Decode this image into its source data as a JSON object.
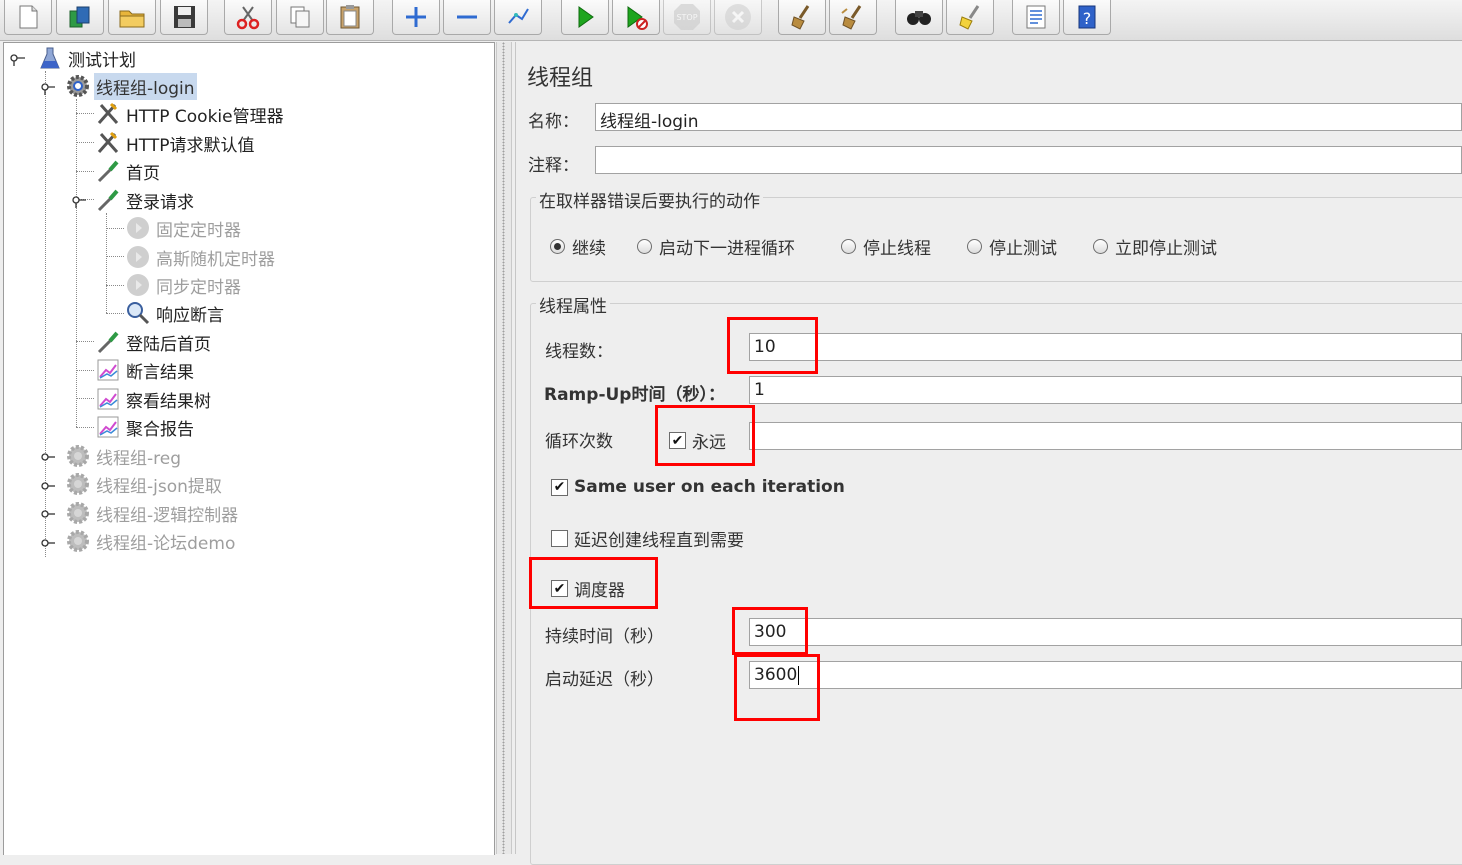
{
  "toolbar": {
    "buttons": [
      {
        "icon": "new-file-icon"
      },
      {
        "icon": "templates-icon"
      },
      {
        "icon": "open-folder-icon"
      },
      {
        "icon": "save-icon"
      },
      {
        "icon": "cut-icon"
      },
      {
        "icon": "copy-icon"
      },
      {
        "icon": "paste-icon"
      },
      {
        "icon": "expand-icon"
      },
      {
        "icon": "collapse-icon"
      },
      {
        "icon": "toggle-icon"
      },
      {
        "icon": "start-icon"
      },
      {
        "icon": "start-no-pauses-icon"
      },
      {
        "icon": "stop-icon",
        "label": "STOP"
      },
      {
        "icon": "shutdown-icon"
      },
      {
        "icon": "clear-icon"
      },
      {
        "icon": "clear-all-icon"
      },
      {
        "icon": "search-icon"
      },
      {
        "icon": "reset-search-icon"
      },
      {
        "icon": "function-helper-icon"
      },
      {
        "icon": "help-icon"
      }
    ]
  },
  "tree": {
    "nodes": [
      {
        "label": "测试计划",
        "icon": "test-plan-icon",
        "state": "normal"
      },
      {
        "label": "线程组-login",
        "icon": "thread-group-icon",
        "state": "selected"
      },
      {
        "label": "HTTP Cookie管理器",
        "icon": "config-element-icon",
        "state": "normal"
      },
      {
        "label": "HTTP请求默认值",
        "icon": "config-element-icon",
        "state": "normal"
      },
      {
        "label": "首页",
        "icon": "sampler-icon",
        "state": "normal"
      },
      {
        "label": "登录请求",
        "icon": "sampler-icon",
        "state": "normal"
      },
      {
        "label": "固定定时器",
        "icon": "timer-icon",
        "state": "disabled"
      },
      {
        "label": "高斯随机定时器",
        "icon": "timer-icon",
        "state": "disabled"
      },
      {
        "label": "同步定时器",
        "icon": "timer-icon",
        "state": "disabled"
      },
      {
        "label": "响应断言",
        "icon": "assertion-icon",
        "state": "normal"
      },
      {
        "label": "登陆后首页",
        "icon": "sampler-icon",
        "state": "normal"
      },
      {
        "label": "断言结果",
        "icon": "listener-icon",
        "state": "normal"
      },
      {
        "label": "察看结果树",
        "icon": "listener-icon",
        "state": "normal"
      },
      {
        "label": "聚合报告",
        "icon": "listener-icon",
        "state": "normal"
      },
      {
        "label": "线程组-reg",
        "icon": "thread-group-icon",
        "state": "disabled"
      },
      {
        "label": "线程组-json提取",
        "icon": "thread-group-icon",
        "state": "disabled"
      },
      {
        "label": "线程组-逻辑控制器",
        "icon": "thread-group-icon",
        "state": "disabled"
      },
      {
        "label": "线程组-论坛demo",
        "icon": "thread-group-icon",
        "state": "disabled"
      }
    ]
  },
  "editor": {
    "title": "线程组",
    "name_label": "名称：",
    "name_value": "线程组-login",
    "comment_label": "注释：",
    "comment_value": "",
    "error_action": {
      "title": "在取样器错误后要执行的动作",
      "options": [
        "继续",
        "启动下一进程循环",
        "停止线程",
        "停止测试",
        "立即停止测试"
      ],
      "selected": "继续"
    },
    "thread_props": {
      "title": "线程属性",
      "threads_label": "线程数：",
      "threads_value": "10",
      "rampup_label": "Ramp-Up时间（秒）：",
      "rampup_value": "1",
      "loop_label": "循环次数",
      "forever_label": "永远",
      "forever_checked": true,
      "same_user_label": "Same user on each iteration",
      "same_user_checked": true,
      "delay_label": "延迟创建线程直到需要",
      "delay_checked": false,
      "scheduler_label": "调度器",
      "scheduler_checked": true,
      "duration_label": "持续时间（秒）",
      "duration_value": "300",
      "startup_delay_label": "启动延迟（秒）",
      "startup_delay_value": "3600"
    }
  },
  "colors": {
    "highlight_box": "#ff0000",
    "selection_bg": "#c8d9ee",
    "disabled_text": "#9e9e9e"
  }
}
